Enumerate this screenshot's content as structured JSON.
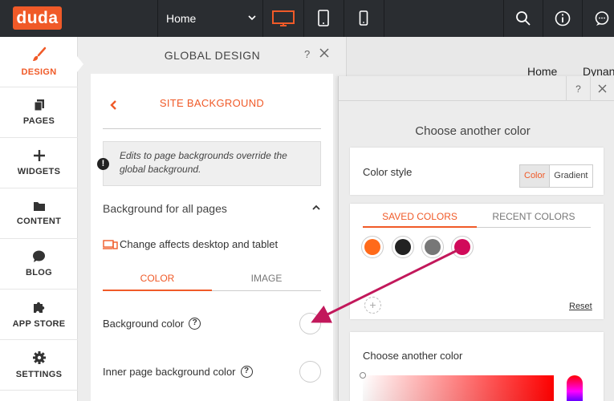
{
  "topbar": {
    "logo": "duda",
    "page_select": "Home"
  },
  "sidebar": {
    "items": [
      {
        "label": "DESIGN"
      },
      {
        "label": "PAGES"
      },
      {
        "label": "WIDGETS"
      },
      {
        "label": "CONTENT"
      },
      {
        "label": "BLOG"
      },
      {
        "label": "APP STORE"
      },
      {
        "label": "SETTINGS"
      }
    ]
  },
  "global_design": {
    "title": "GLOBAL DESIGN",
    "help": "?",
    "site_background": {
      "title": "SITE BACKGROUND",
      "note": "Edits to page backgrounds override the global background.",
      "note_icon": "!",
      "section": "Background for all pages",
      "affects": "Change affects desktop and tablet",
      "tabs": [
        "COLOR",
        "IMAGE"
      ],
      "fields": [
        {
          "label": "Background color"
        },
        {
          "label": "Inner page background color"
        }
      ]
    }
  },
  "preview": {
    "nav": [
      "Home",
      "Dynan"
    ]
  },
  "color_picker": {
    "help": "?",
    "title": "Choose another color",
    "color_style_label": "Color style",
    "style_options": [
      "Color",
      "Gradient"
    ],
    "palette_tabs": [
      "SAVED COLORS",
      "RECENT COLORS"
    ],
    "saved_colors": [
      "#ff6a1a",
      "#222222",
      "#777777",
      "#d10a5a"
    ],
    "add_symbol": "+",
    "reset": "Reset",
    "choose_label": "Choose another color"
  },
  "colors": {
    "accent": "#f05a28",
    "topbar": "#2a2d31",
    "arrow": "#c2185b"
  }
}
